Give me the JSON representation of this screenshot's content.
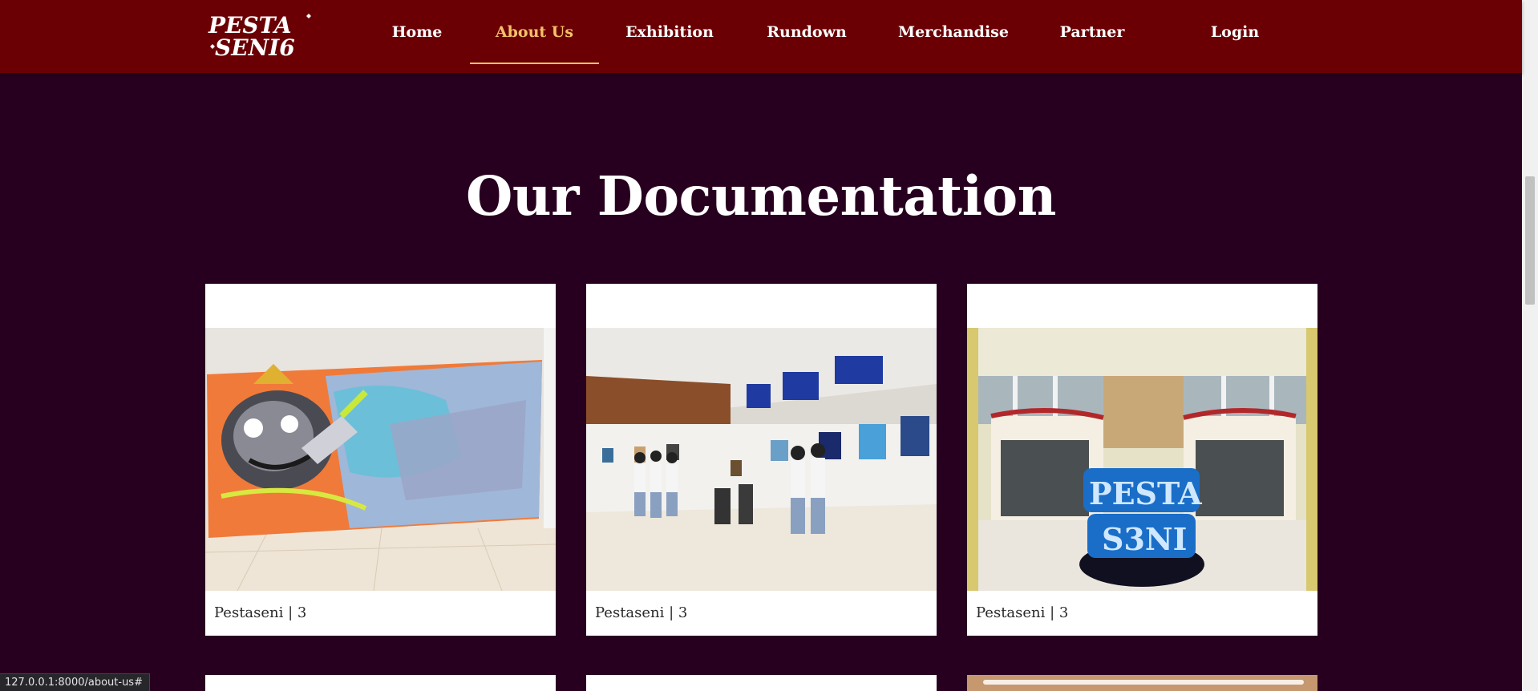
{
  "nav": {
    "logo_text": "PESTA SENI 6",
    "items": [
      {
        "label": "Home"
      },
      {
        "label": "About Us"
      },
      {
        "label": "Exhibition"
      },
      {
        "label": "Rundown"
      },
      {
        "label": "Merchandise"
      },
      {
        "label": "Partner"
      },
      {
        "label": "Login"
      }
    ],
    "active_item": "About Us"
  },
  "documentation": {
    "title": "Our Documentation",
    "cards": [
      {
        "caption": "Pestaseni | 3",
        "photo": "graffiti-mural-photo"
      },
      {
        "caption": "Pestaseni | 3",
        "photo": "exhibition-hall-photo"
      },
      {
        "caption": "Pestaseni | 3",
        "photo": "pesta-seni-entrance-photo"
      }
    ]
  },
  "status_bar": {
    "url": "127.0.0.1:8000/about-us#"
  },
  "colors": {
    "header_bg": "#6a0003",
    "page_bg": "#28001f",
    "active_nav": "#f3c16a",
    "card_bg": "#ffffff"
  }
}
